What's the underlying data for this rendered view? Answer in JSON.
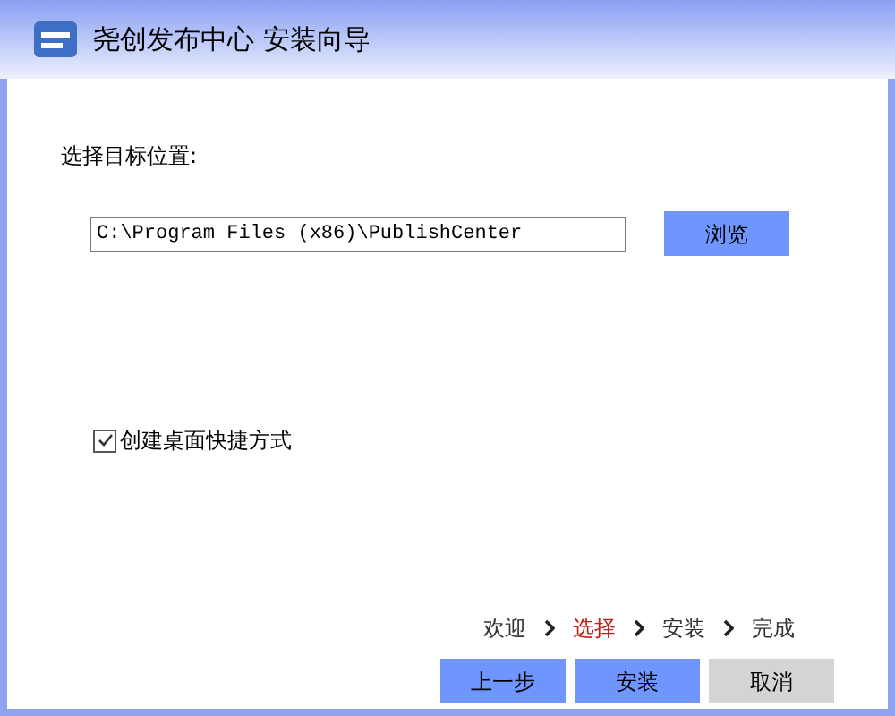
{
  "window": {
    "title": "尧创发布中心 安装向导"
  },
  "location": {
    "label": "选择目标位置:",
    "value": "C:\\Program Files (x86)\\PublishCenter",
    "browse_button": "浏览"
  },
  "shortcut": {
    "label": "创建桌面快捷方式",
    "checked": true
  },
  "steps": [
    {
      "label": "欢迎",
      "selected": false
    },
    {
      "label": "选择",
      "selected": true
    },
    {
      "label": "安装",
      "selected": false
    },
    {
      "label": "完成",
      "selected": false
    }
  ],
  "buttons": [
    {
      "label": "上一步",
      "kind": "primary"
    },
    {
      "label": "安装",
      "kind": "primary"
    },
    {
      "label": "取消",
      "kind": "default"
    }
  ]
}
